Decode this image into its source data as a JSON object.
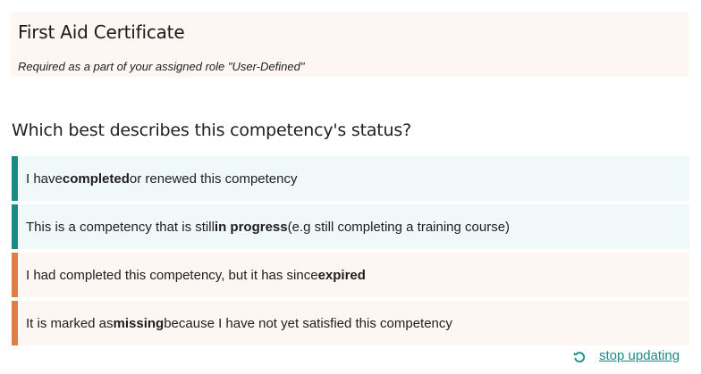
{
  "header": {
    "title": "First Aid Certificate",
    "subtitle": "Required as a part of your assigned role \"User-Defined\""
  },
  "question": "Which best describes this competency's status?",
  "colors": {
    "teal": "#1a8a87",
    "orange": "#e07e44",
    "teal_bg": "#f1f8f8",
    "orange_bg": "#fdf6f2",
    "link": "#1a8a87"
  },
  "options": [
    {
      "status": "completed",
      "pre": "I have ",
      "bold": "completed",
      "post": " or renewed this competency"
    },
    {
      "status": "in-progress",
      "pre": "This is a competency that is still ",
      "bold": "in progress",
      "post": " (e.g still completing a training course)"
    },
    {
      "status": "expired",
      "pre": "I had completed this competency, but it has since ",
      "bold": "expired",
      "post": ""
    },
    {
      "status": "missing",
      "pre": "It is marked as ",
      "bold": "missing",
      "post": " because I have not yet satisfied this competency"
    }
  ],
  "footer": {
    "icon": "refresh-icon",
    "link_label": "stop updating"
  }
}
